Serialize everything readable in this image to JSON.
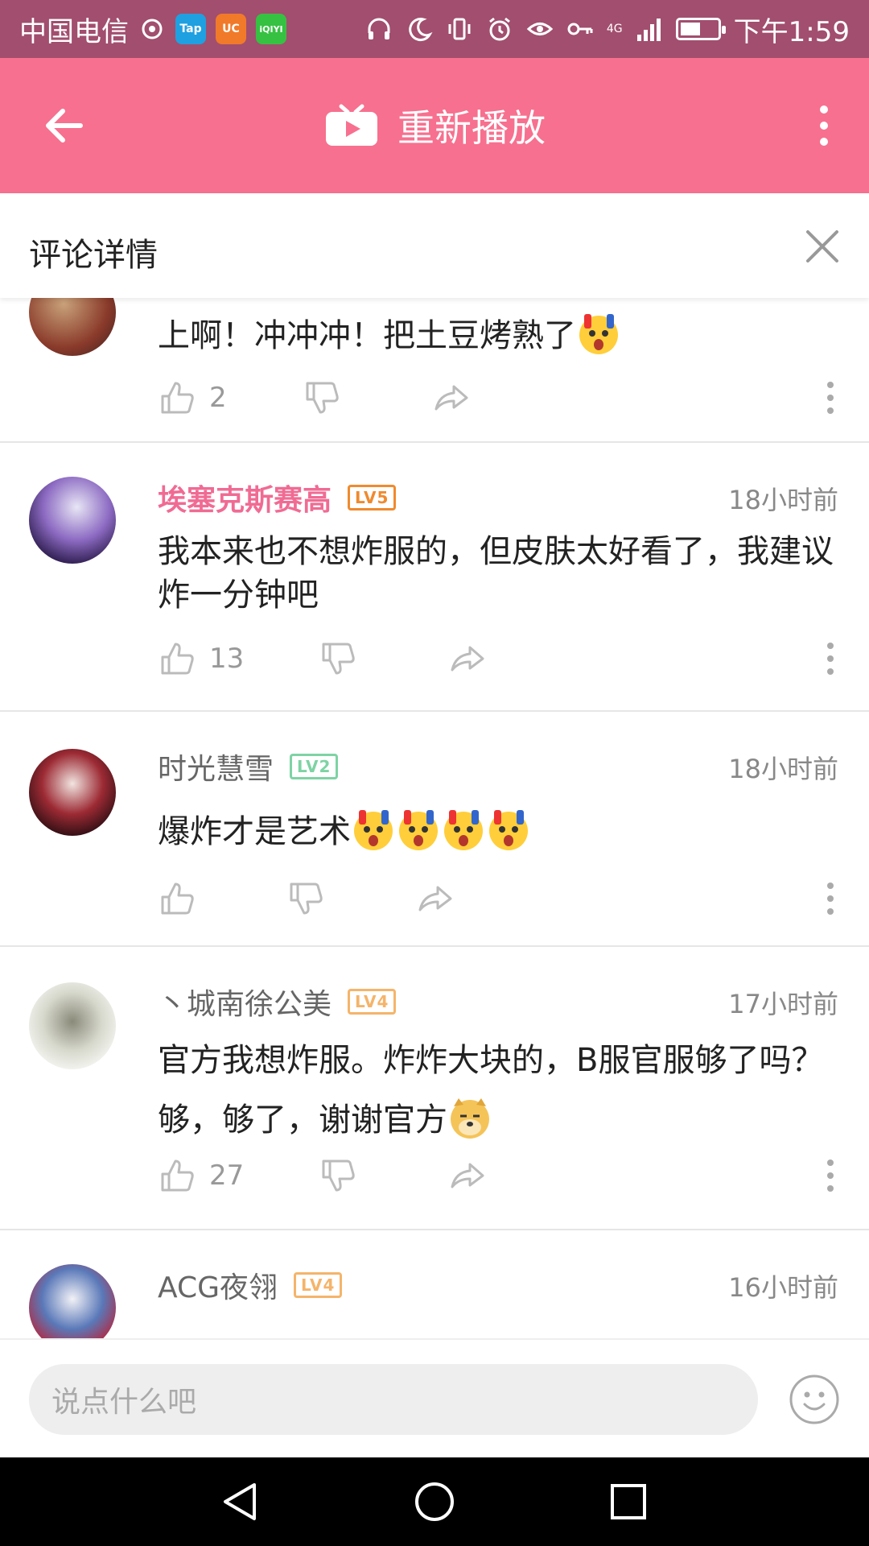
{
  "status_bar": {
    "carrier": "中国电信",
    "app_icons": [
      {
        "name": "tap",
        "label": "Tap",
        "color": "#1fa0e0"
      },
      {
        "name": "uc",
        "label": "UC",
        "color": "#f07a2a"
      },
      {
        "name": "iqiyi",
        "label": "iQIYI",
        "color": "#36c142"
      }
    ],
    "network": "4G",
    "time": "下午1:59",
    "battery_level": 0.55
  },
  "top_bar": {
    "title": "重新播放",
    "accent": "#f7708f"
  },
  "panel": {
    "title": "评论详情"
  },
  "comments": [
    {
      "username": "",
      "level": "",
      "time": "",
      "text": "上啊！冲冲冲！把土豆烤熟了",
      "emojis": [
        "shock-emoji"
      ],
      "likes": "2",
      "avatar": "avatar-red"
    },
    {
      "username": "埃塞克斯赛高",
      "level": "LV5",
      "level_color": "#f08a2e",
      "vip": true,
      "time": "18小时前",
      "text": "我本来也不想炸服的，但皮肤太好看了，我建议炸一分钟吧",
      "emojis": [],
      "likes": "13",
      "avatar": "avatar-purple"
    },
    {
      "username": "时光慧雪",
      "level": "LV2",
      "level_color": "#7ed3a4",
      "vip": false,
      "time": "18小时前",
      "text": "爆炸才是艺术",
      "emojis": [
        "shock-emoji",
        "shock-emoji",
        "shock-emoji",
        "shock-emoji"
      ],
      "likes": "",
      "avatar": "avatar-dark-red"
    },
    {
      "username": "丶城南徐公美",
      "level": "LV4",
      "level_color": "#f5b46a",
      "vip": false,
      "time": "17小时前",
      "text": "官方我想炸服。炸炸大块的，B服官服够了吗？够，够了，谢谢官方",
      "emojis": [
        "doge-emoji"
      ],
      "likes": "27",
      "avatar": "avatar-face"
    },
    {
      "username": "ACG夜翎",
      "level": "LV4",
      "level_color": "#f5b46a",
      "vip": false,
      "time": "16小时前",
      "text": "",
      "emojis": [],
      "likes": "",
      "avatar": "avatar-blue"
    }
  ],
  "input": {
    "placeholder": "说点什么吧"
  }
}
